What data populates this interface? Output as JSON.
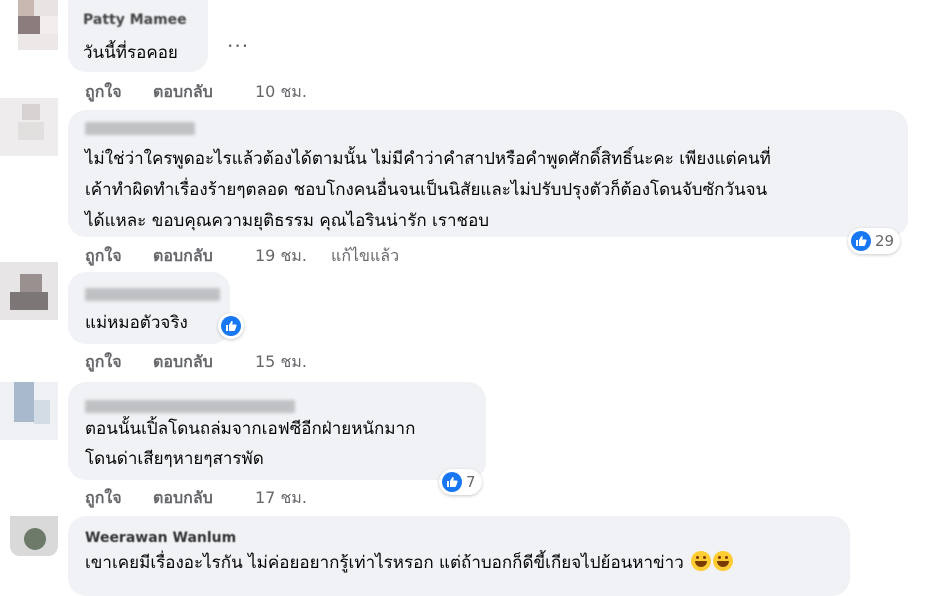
{
  "comments": [
    {
      "author": "Patty Mamee",
      "text_lines": [
        "วันนี้ที่รอคอย"
      ],
      "actions": {
        "like": "ถูกใจ",
        "reply": "ตอบกลับ",
        "time": "10 ชม."
      },
      "more": "..."
    },
    {
      "author": "",
      "text_lines": [
        "ไม่ใช่ว่าใครพูดอะไรแล้วต้องได้ตามนั้น ไม่มีคำว่าคำสาปหรือคำพูดศักดิ์สิทธิ์นะคะ เพียงแต่คนที่",
        "เค้าทำผิดทำเรื่องร้ายๆตลอด ชอบโกงคนอื่นจนเป็นนิสัยและไม่ปรับปรุงตัวก็ต้องโดนจับซักวันจน",
        "ได้แหละ ขอบคุณความยุติธรรม คุณไอรินน่ารัก เราชอบ"
      ],
      "actions": {
        "like": "ถูกใจ",
        "reply": "ตอบกลับ",
        "time": "19 ชม.",
        "edited": "แก้ไขแล้ว"
      },
      "reactions": {
        "icon": "like-icon",
        "count": "29"
      }
    },
    {
      "author": "",
      "text_lines": [
        "แม่หมอตัวจริง"
      ],
      "actions": {
        "like": "ถูกใจ",
        "reply": "ตอบกลับ",
        "time": "15 ชม."
      },
      "reactions": {
        "icon": "like-icon",
        "count": ""
      }
    },
    {
      "author": "",
      "text_lines": [
        "ตอนนั้นเปิ้ลโดนถล่มจากเอฟซีอีกฝ่ายหนักมาก",
        "โดนด่าเสียๆหายๆสารพัด"
      ],
      "actions": {
        "like": "ถูกใจ",
        "reply": "ตอบกลับ",
        "time": "17 ชม."
      },
      "reactions": {
        "icon": "like-icon",
        "count": "7"
      }
    },
    {
      "author": "Weerawan Wanlum",
      "text_lines": [
        "เขาเคยมีเรื่องอะไรกัน ไม่ค่อยอยากรู้เท่าไรหรอก แต่ถ้าบอกก็ดีขี้เกียจไปย้อนหาข่าว"
      ],
      "emojis": [
        "grin-emoji",
        "laughing-emoji"
      ]
    }
  ],
  "colors": {
    "bubble": "#f0f2f5",
    "meta": "#65676b",
    "like": "#1877f2"
  }
}
